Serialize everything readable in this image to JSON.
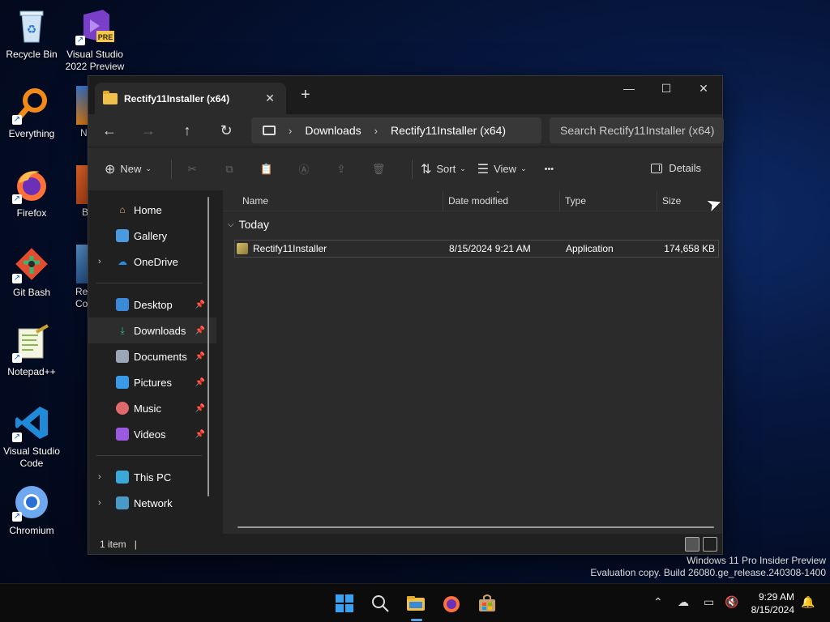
{
  "desktop": {
    "icons": [
      {
        "label": "Recycle Bin"
      },
      {
        "label": "Visual Studio 2022 Preview",
        "badge": "PRE"
      },
      {
        "label": "Everything"
      },
      {
        "label": "Firefox"
      },
      {
        "label": "Git Bash"
      },
      {
        "label": "Notepad++"
      },
      {
        "label": "Visual Studio Code"
      },
      {
        "label": "Chromium"
      }
    ],
    "partial_labels": [
      "N",
      "B",
      "Re",
      "Co"
    ]
  },
  "explorer": {
    "tab_title": "Rectify11Installer (x64)",
    "breadcrumb": [
      "Downloads",
      "Rectify11Installer (x64)"
    ],
    "search_placeholder": "Search Rectify11Installer (x64)",
    "commands": {
      "new": "New",
      "sort": "Sort",
      "view": "View",
      "more": "•••",
      "details": "Details"
    },
    "sidebar": {
      "top": [
        {
          "label": "Home"
        },
        {
          "label": "Gallery"
        },
        {
          "label": "OneDrive"
        }
      ],
      "quick": [
        {
          "label": "Desktop"
        },
        {
          "label": "Downloads"
        },
        {
          "label": "Documents"
        },
        {
          "label": "Pictures"
        },
        {
          "label": "Music"
        },
        {
          "label": "Videos"
        }
      ],
      "bottom": [
        {
          "label": "This PC"
        },
        {
          "label": "Network"
        }
      ]
    },
    "columns": {
      "name": "Name",
      "date": "Date modified",
      "type": "Type",
      "size": "Size"
    },
    "group_label": "Today",
    "files": [
      {
        "name": "Rectify11Installer",
        "date": "8/15/2024 9:21 AM",
        "type": "Application",
        "size": "174,658 KB"
      }
    ],
    "status": "1 item"
  },
  "watermark": {
    "line1": "Windows 11 Pro Insider Preview",
    "line2": "Evaluation copy. Build 26080.ge_release.240308-1400"
  },
  "taskbar": {
    "time": "9:29 AM",
    "date": "8/15/2024"
  },
  "colors": {
    "accent": "#5aa0e6",
    "window_bg": "#202020",
    "content_bg": "#2b2b2b"
  }
}
